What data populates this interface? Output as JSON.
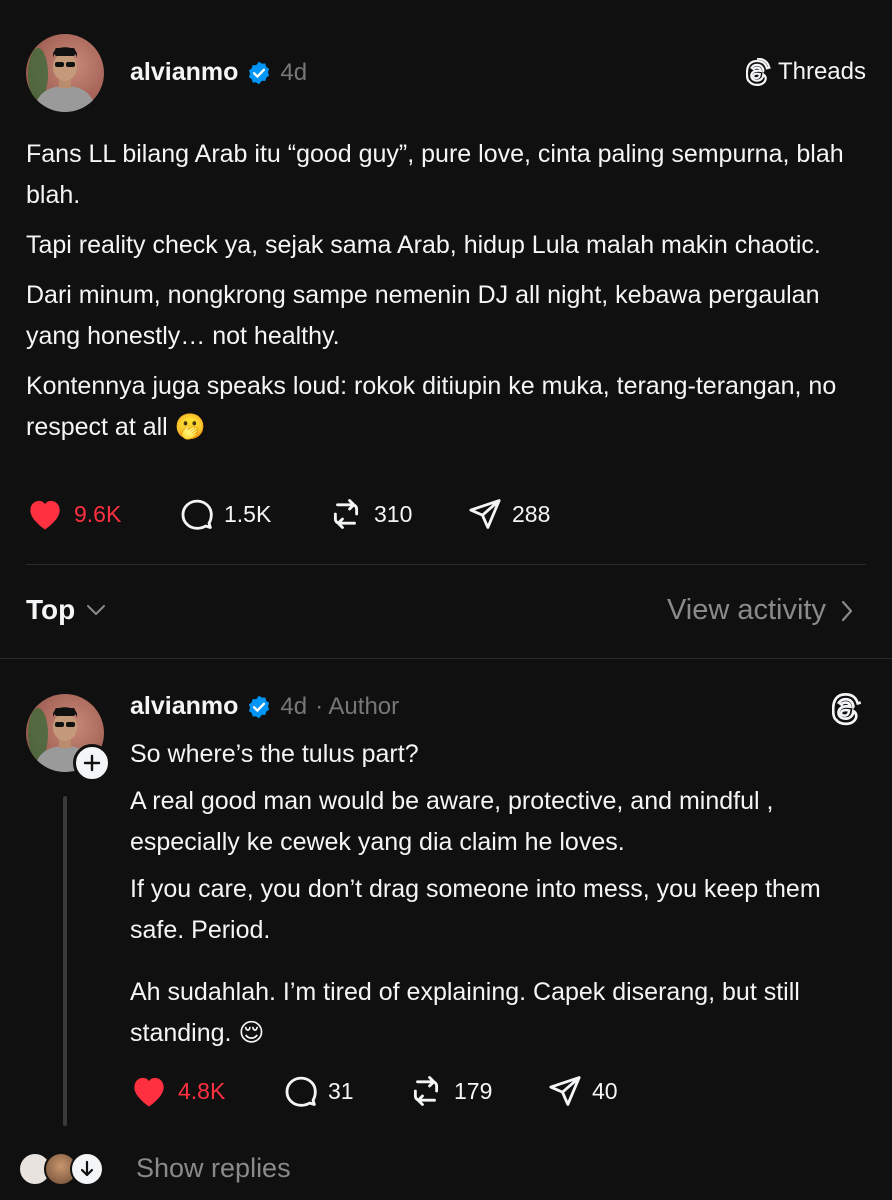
{
  "post": {
    "username": "alvianmo",
    "time": "4d",
    "brand": "Threads",
    "paragraphs": [
      "Fans LL bilang Arab itu “good guy”, pure love, cinta paling sempurna, blah blah.",
      "Tapi reality check ya, sejak sama Arab, hidup Lula malah makin chaotic.",
      "Dari minum, nongkrong sampe nemenin DJ all night, kebawa pergaulan yang honestly… not healthy.",
      "Kontennya juga speaks loud: rokok ditiupin ke muka, terang-terangan, no respect at all 🫢"
    ],
    "likes": "9.6K",
    "comments": "1.5K",
    "reposts": "310",
    "shares": "288"
  },
  "sort": {
    "label": "Top",
    "view_activity": "View activity"
  },
  "reply": {
    "username": "alvianmo",
    "time": "4d",
    "author_tag": "· Author",
    "paragraphs": [
      "So where’s the tulus part?",
      "A real good man would be aware, protective, and mindful , especially ke cewek yang dia claim he loves.",
      "If you care, you don’t drag someone into mess, you keep them safe. Period.",
      "Ah sudahlah. I’m tired of explaining. Capek diserang, but still standing. 😌"
    ],
    "likes": "4.8K",
    "comments": "31",
    "reposts": "179",
    "shares": "40"
  },
  "footer": {
    "show_replies": "Show replies"
  },
  "colors": {
    "background": "#101010",
    "text": "#f3f5f7",
    "muted": "#777777",
    "like": "#ff3040",
    "verified": "#0095f6"
  },
  "icons": [
    "heart-icon",
    "comment-icon",
    "repost-icon",
    "share-icon",
    "threads-logo-icon",
    "verified-icon",
    "chevron-down-icon",
    "chevron-right-icon",
    "plus-icon",
    "arrow-down-icon"
  ]
}
